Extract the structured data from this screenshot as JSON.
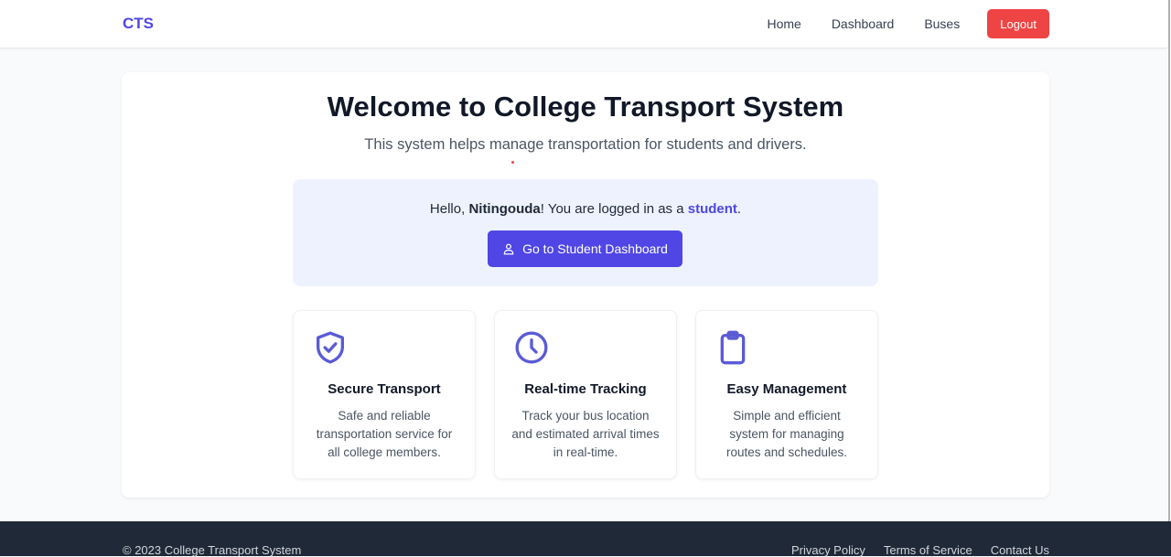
{
  "nav": {
    "brand": "CTS",
    "links": [
      "Home",
      "Dashboard",
      "Buses"
    ],
    "logout": "Logout"
  },
  "hero": {
    "title": "Welcome to College Transport System",
    "subtitle": "This system helps manage transportation for students and drivers."
  },
  "welcome": {
    "prefix": "Hello, ",
    "name": "Nitingouda",
    "middle": "! You are logged in as a ",
    "role": "student",
    "suffix": ".",
    "button_label": "Go to Student Dashboard",
    "button_icon": "user-icon"
  },
  "features": [
    {
      "icon": "shield-check-icon",
      "title": "Secure Transport",
      "description": "Safe and reliable transportation service for all college members."
    },
    {
      "icon": "clock-icon",
      "title": "Real-time Tracking",
      "description": "Track your bus location and estimated arrival times in real-time."
    },
    {
      "icon": "clipboard-icon",
      "title": "Easy Management",
      "description": "Simple and efficient system for managing routes and schedules."
    }
  ],
  "footer": {
    "copyright": "© 2023 College Transport System",
    "links": [
      "Privacy Policy",
      "Terms of Service",
      "Contact Us"
    ]
  },
  "colors": {
    "accent": "#4f46e5",
    "danger": "#ef4444",
    "footer_bg": "#1f2937",
    "welcome_bg": "#eef2ff"
  }
}
